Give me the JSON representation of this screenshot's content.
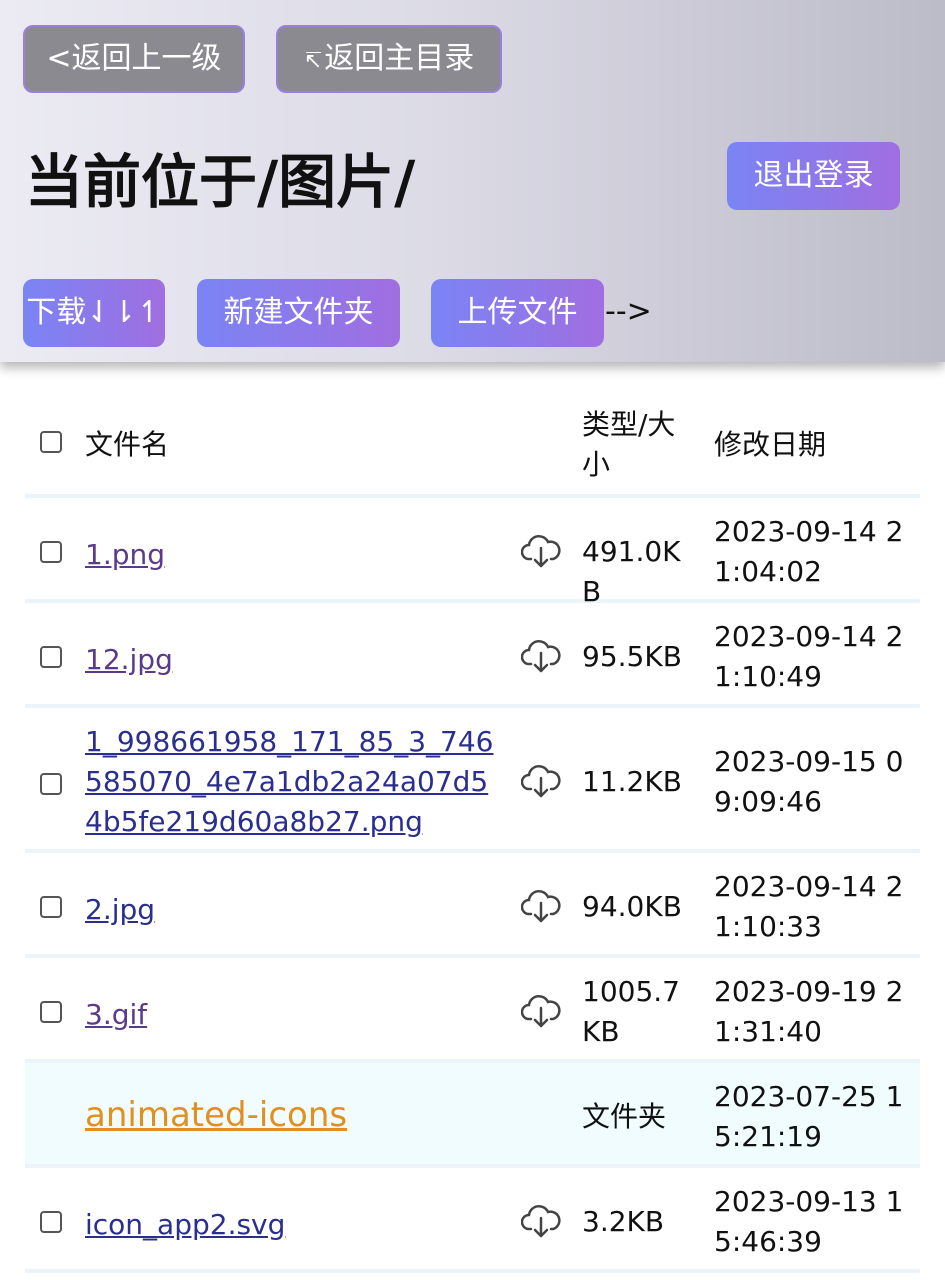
{
  "nav": {
    "back_label": "<返回上一级",
    "home_icon": "↸",
    "home_label": "返回主目录"
  },
  "header": {
    "title": "当前位于/图片/",
    "logout_label": "退出登录"
  },
  "toolbar": {
    "download_label": "下载⇃⇂↿",
    "new_folder_label": "新建文件夹",
    "upload_label": "上传文件",
    "trailing_text": "-->"
  },
  "table": {
    "columns": {
      "name": "文件名",
      "type_size": "类型/大小",
      "modified": "修改日期"
    },
    "rows": [
      {
        "name": "1.png",
        "size": "491.0KB",
        "date": "2023-09-14 21:04:02"
      },
      {
        "name": "12.jpg",
        "size": "95.5KB",
        "date": "2023-09-14 21:10:49"
      },
      {
        "name": "1_998661958_171_85_3_746585070_4e7a1db2a24a07d54b5fe219d60a8b27.png",
        "size": "11.2KB",
        "date": "2023-09-15 09:09:46"
      },
      {
        "name": "2.jpg",
        "size": "94.0KB",
        "date": "2023-09-14 21:10:33"
      },
      {
        "name": "3.gif",
        "size": "1005.7KB",
        "date": "2023-09-19 21:31:40"
      },
      {
        "name": "animated-icons",
        "size": "文件夹",
        "date": "2023-07-25 15:21:19"
      },
      {
        "name": "icon_app2.svg",
        "size": "3.2KB",
        "date": "2023-09-13 15:46:39"
      }
    ]
  },
  "colors": {
    "accent_start": "#7a84f5",
    "accent_end": "#a06ee0",
    "folder_link": "#e0901f",
    "file_link": "#2a2f8f"
  },
  "icons": {
    "download": "cloud-download-icon"
  }
}
